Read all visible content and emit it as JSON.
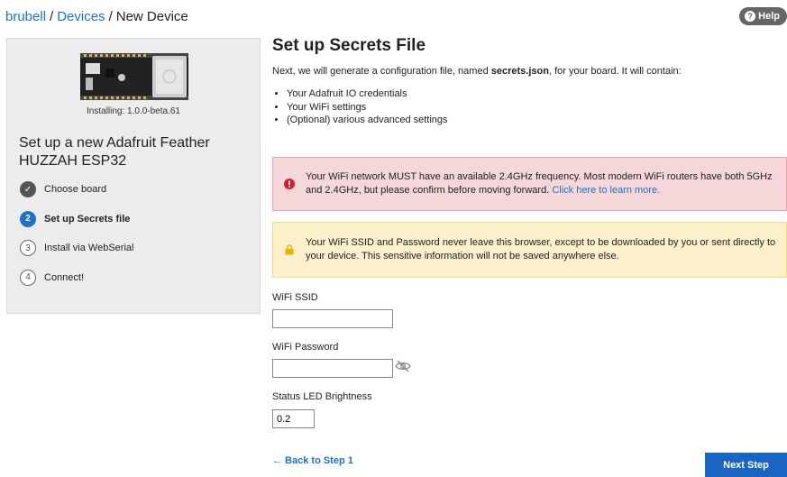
{
  "breadcrumb": {
    "user": "brubell",
    "devices": "Devices",
    "current": "New Device",
    "separator": "/"
  },
  "help": {
    "label": "Help"
  },
  "sidebar": {
    "installing": "Installing: 1.0.0-beta.61",
    "title": "Set up a new Adafruit Feather HUZZAH ESP32",
    "steps": [
      {
        "marker": "✓",
        "label": "Choose board",
        "state": "done"
      },
      {
        "marker": "2",
        "label": "Set up Secrets file",
        "state": "active"
      },
      {
        "marker": "3",
        "label": "Install via WebSerial",
        "state": "todo"
      },
      {
        "marker": "4",
        "label": "Connect!",
        "state": "todo"
      }
    ]
  },
  "main": {
    "title": "Set up Secrets File",
    "intro_before": "Next, we will generate a configuration file, named ",
    "intro_file": "secrets.json",
    "intro_after": ", for your board. It will contain:",
    "bullets": [
      "Your Adafruit IO credentials",
      "Your WiFi settings",
      "(Optional) various advanced settings"
    ]
  },
  "alerts": {
    "warning_text": "Your WiFi network MUST have an available 2.4GHz frequency. Most modern WiFi routers have both 5GHz and 2.4GHz, but please confirm before moving forward. ",
    "warning_link": "Click here to learn more.",
    "privacy_text": "Your WiFi SSID and Password never leave this browser, except to be downloaded by you or sent directly to your device. This sensitive information will not be saved anywhere else."
  },
  "form": {
    "ssid_label": "WiFi SSID",
    "ssid_value": "",
    "password_label": "WiFi Password",
    "password_value": "",
    "brightness_label": "Status LED Brightness",
    "brightness_value": "0.2"
  },
  "nav": {
    "back": "← Back to Step 1",
    "next": "Next Step"
  },
  "colors": {
    "accent": "#1a73c8",
    "error_bg": "#f6d7d9",
    "warning_bg": "#fbf0c9",
    "error_icon": "#d0202e",
    "warning_icon": "#e8b400"
  }
}
